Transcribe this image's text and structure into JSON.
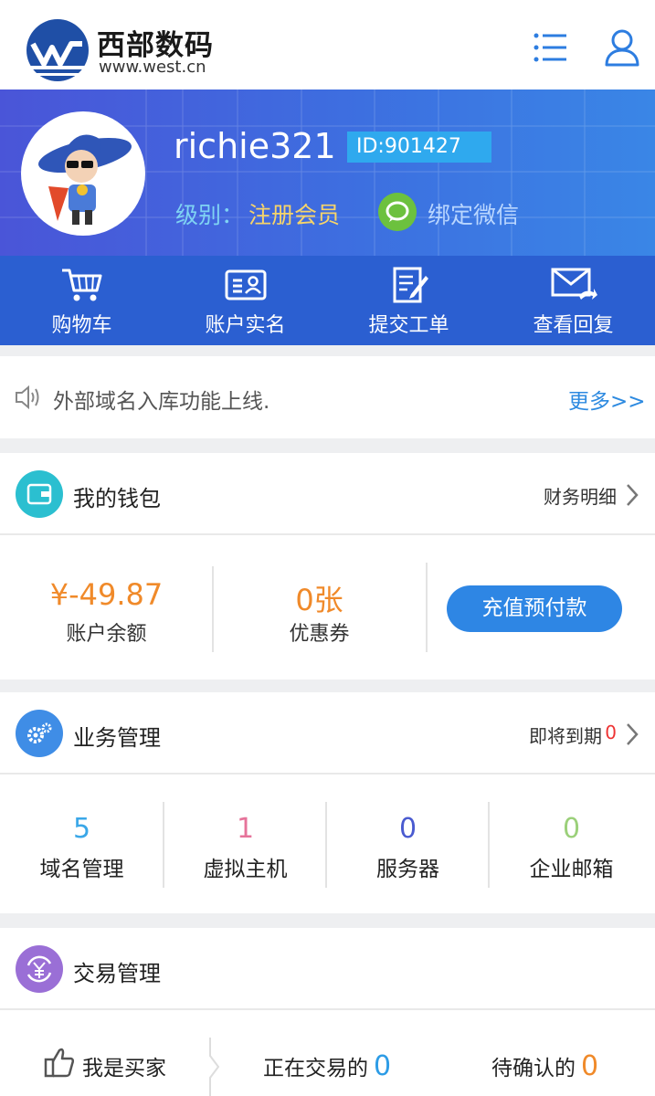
{
  "header": {
    "brand_name": "西部数码",
    "brand_url": "www.west.cn",
    "menu_icon": "list-menu-icon",
    "user_icon": "user-icon"
  },
  "profile": {
    "username": "richie321",
    "id_text": "ID:901427",
    "level_label": "级别：",
    "level_value": "注册会员",
    "wechat_label": "绑定微信"
  },
  "quickbar": {
    "items": [
      {
        "label": "购物车",
        "icon": "cart-icon"
      },
      {
        "label": "账户实名",
        "icon": "id-card-icon"
      },
      {
        "label": "提交工单",
        "icon": "edit-ticket-icon"
      },
      {
        "label": "查看回复",
        "icon": "mail-reply-icon"
      }
    ]
  },
  "notice": {
    "text": "外部域名入库功能上线.",
    "more": "更多>>"
  },
  "wallet": {
    "title": "我的钱包",
    "detail_link": "财务明细",
    "balance": "¥-49.87",
    "balance_label": "账户余额",
    "coupons": "0张",
    "coupons_label": "优惠券",
    "recharge_button": "充值预付款"
  },
  "business": {
    "title": "业务管理",
    "expiring_label": "即将到期",
    "expiring_count": "0",
    "items": [
      {
        "count": "5",
        "label": "域名管理",
        "color": "#3aa7e8"
      },
      {
        "count": "1",
        "label": "虚拟主机",
        "color": "#e6739a"
      },
      {
        "count": "0",
        "label": "服务器",
        "color": "#4a5bd0"
      },
      {
        "count": "0",
        "label": "企业邮箱",
        "color": "#9bd07a"
      }
    ]
  },
  "trade": {
    "title": "交易管理",
    "buyer_label": "我是买家",
    "trading_label": "正在交易的",
    "trading_count": "0",
    "pending_label": "待确认的",
    "pending_count": "0"
  },
  "colors": {
    "accent_blue": "#2e86e4",
    "quickbar_blue": "#2b5fd1",
    "amount_orange": "#f08a2a"
  }
}
